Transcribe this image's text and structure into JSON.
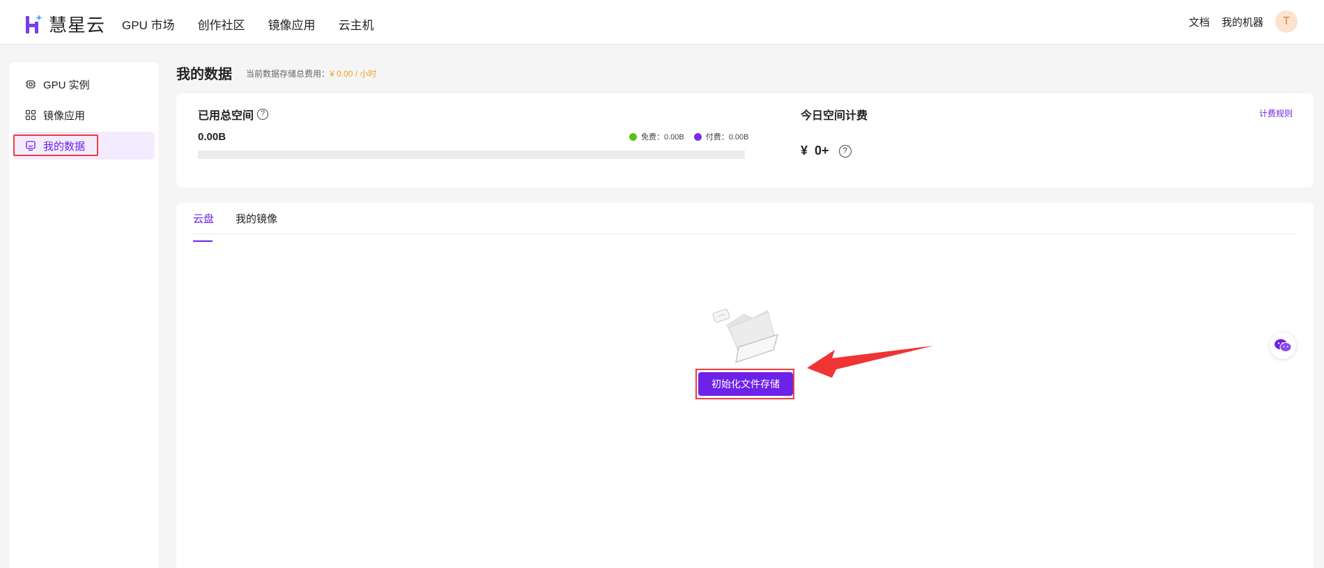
{
  "brand": {
    "name": "慧星云",
    "accent": "#6e22e8",
    "logo_color": "#7a3cf0"
  },
  "nav": {
    "items": [
      {
        "label": "GPU 市场"
      },
      {
        "label": "创作社区"
      },
      {
        "label": "镜像应用"
      },
      {
        "label": "云主机"
      }
    ],
    "right": {
      "docs": "文档",
      "my_machines": "我的机器",
      "avatar_letter": "T"
    }
  },
  "sidebar": {
    "items": [
      {
        "label": "GPU 实例",
        "icon": "chip-icon",
        "active": false
      },
      {
        "label": "镜像应用",
        "icon": "grid-apps-icon",
        "active": false
      },
      {
        "label": "我的数据",
        "icon": "data-monitor-icon",
        "active": true
      }
    ]
  },
  "page": {
    "title": "我的数据",
    "cost_label": "当前数据存储总费用：",
    "cost_value": "¥ 0.00 / 小时"
  },
  "summary": {
    "used_title": "已用总空间",
    "used_value": "0.00B",
    "legend": [
      {
        "label": "免费：0.00B",
        "color": "#52c41a"
      },
      {
        "label": "付费：0.00B",
        "color": "#7a2de8"
      }
    ],
    "usage_fraction": 0.0,
    "today_title": "今日空间计费",
    "today_value": "¥  0+",
    "rules_link": "计费规则"
  },
  "tabs": [
    {
      "label": "云盘",
      "active": true
    },
    {
      "label": "我的镜像",
      "active": false
    }
  ],
  "empty_state": {
    "icon": "empty-folder-icon",
    "button_label": "初始化文件存储"
  },
  "floating": {
    "icon": "wechat-icon"
  },
  "annotation": {
    "highlight_color": "#ef3b3b"
  }
}
